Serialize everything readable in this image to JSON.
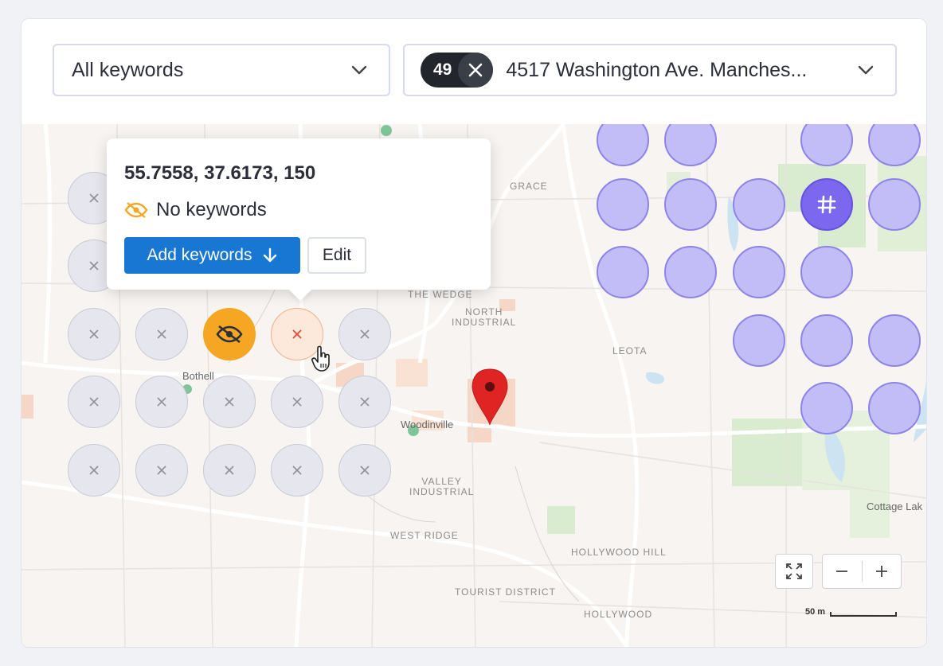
{
  "filters": {
    "keyword_select": {
      "value": "All keywords"
    },
    "location_select": {
      "count": "49",
      "value": "4517 Washington Ave. Manches..."
    }
  },
  "tooltip": {
    "coords": "55.7558, 37.6173, 150",
    "status": "No keywords",
    "add_button": "Add keywords",
    "edit_button": "Edit"
  },
  "map": {
    "labels": {
      "grace": "GRACE",
      "wedge": "THE WEDGE",
      "north_industrial": "NORTH\nINDUSTRIAL",
      "leota": "LEOTA",
      "valley_industrial": "VALLEY\nINDUSTRIAL",
      "west_ridge": "WEST RIDGE",
      "hollywood_hill": "HOLLYWOOD HILL",
      "tourist_district": "TOURIST DISTRICT",
      "hollywood": "HOLLYWOOD",
      "bothell": "Bothell",
      "woodinville": "Woodinville",
      "cottage_lake": "Cottage Lak"
    },
    "scale": "50 m",
    "colors": {
      "purple_point": "#c2bdf6",
      "selected_point": "#7b68ee",
      "no_keywords_point": "#f5a623",
      "pin": "#e02424",
      "primary_button": "#1877d2"
    }
  }
}
